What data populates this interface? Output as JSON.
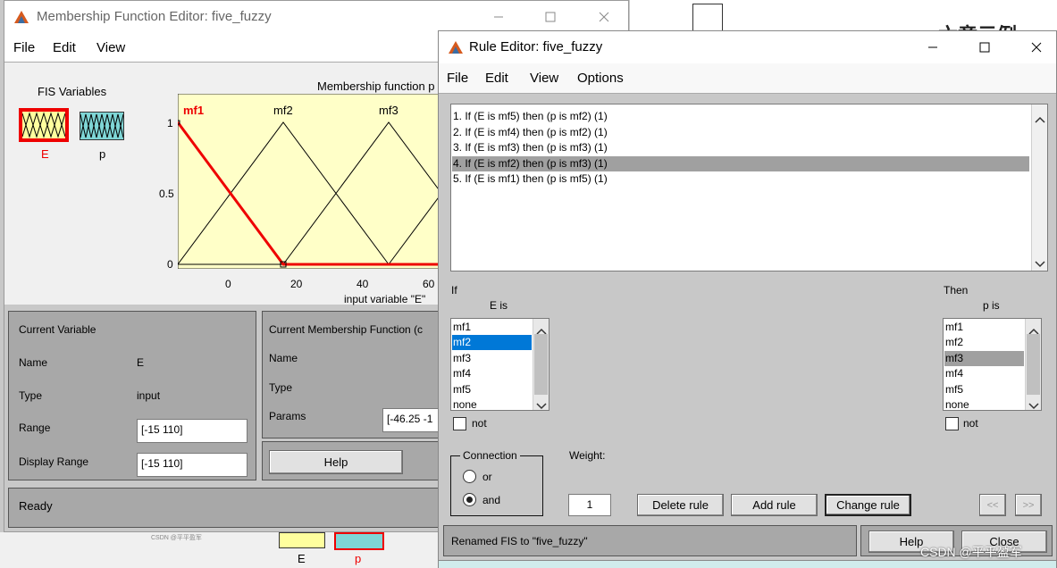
{
  "bg": {
    "right_text": "六章示例"
  },
  "mf_editor": {
    "title": "Membership Function Editor: five_fuzzy",
    "menu": [
      "File",
      "Edit",
      "View"
    ],
    "fis_vars_label": "FIS Variables",
    "vars": [
      {
        "name": "E"
      },
      {
        "name": "p"
      }
    ],
    "plot": {
      "title": "Membership function p",
      "xlabel": "input variable \"E\"",
      "xticks": [
        "0",
        "20",
        "40",
        "60"
      ],
      "yticks": [
        "1",
        "0.5",
        "0"
      ],
      "mf_labels": [
        "mf1",
        "mf2",
        "mf3"
      ]
    },
    "current_variable": {
      "title": "Current Variable",
      "name_label": "Name",
      "name_value": "E",
      "type_label": "Type",
      "type_value": "input",
      "range_label": "Range",
      "range_value": "[-15 110]",
      "display_range_label": "Display Range",
      "display_range_value": "[-15 110]"
    },
    "current_mf": {
      "title": "Current Membership Function (c",
      "name_label": "Name",
      "type_label": "Type",
      "params_label": "Params",
      "params_value": "[-46.25 -1"
    },
    "help_label": "Help",
    "status": "Ready",
    "watermark": "CSDN @平平盈军"
  },
  "bottom_strip": {
    "labels": [
      "E",
      "p"
    ]
  },
  "rule_editor": {
    "title": "Rule Editor: five_fuzzy",
    "menu": [
      "File",
      "Edit",
      "View",
      "Options"
    ],
    "rules": [
      "1. If (E is mf5) then (p is mf2) (1)",
      "2. If (E is mf4) then (p is mf2) (1)",
      "3. If (E is mf3) then (p is mf3) (1)",
      "4. If (E is mf2) then (p is mf3) (1)",
      "5. If (E is mf1) then (p is mf5) (1)"
    ],
    "selected_rule": 3,
    "if_label": "If",
    "then_label": "Then",
    "input_var_label": "E is",
    "output_var_label": "p is",
    "input_options": [
      "mf1",
      "mf2",
      "mf3",
      "mf4",
      "mf5",
      "none"
    ],
    "input_selected": 1,
    "output_options": [
      "mf1",
      "mf2",
      "mf3",
      "mf4",
      "mf5",
      "none"
    ],
    "output_selected": 2,
    "not_label": "not",
    "connection_label": "Connection",
    "or_label": "or",
    "and_label": "and",
    "connection_selected": "and",
    "weight_label": "Weight:",
    "weight_value": "1",
    "delete_rule": "Delete rule",
    "add_rule": "Add rule",
    "change_rule": "Change rule",
    "prev_label": "<<",
    "next_label": ">>",
    "status": "Renamed FIS to \"five_fuzzy\"",
    "help_label": "Help",
    "close_label": "Close"
  },
  "watermark": "CSDN @平平盈军"
}
